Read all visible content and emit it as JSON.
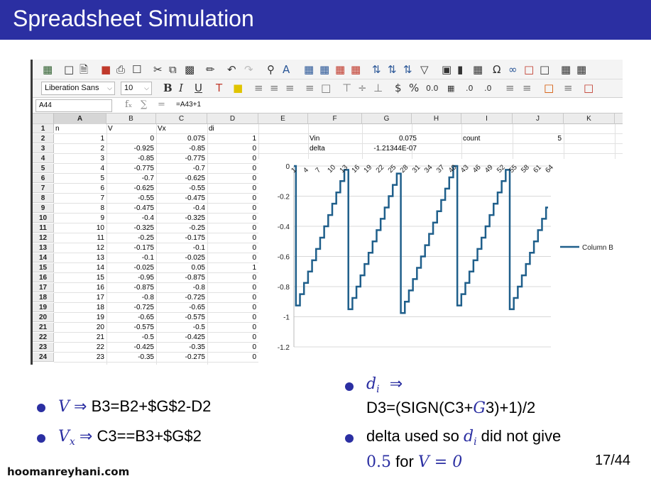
{
  "slide": {
    "title": "Spreadsheet Simulation",
    "page_number": "17/44",
    "watermark": "hoomanreyhani.com"
  },
  "spreadsheet": {
    "font_name": "Liberation Sans",
    "font_size": "10",
    "cell_ref": "A44",
    "formula": "=A43+1",
    "fx_symbol": "fₓ",
    "sum_symbol": "∑",
    "eq_symbol": "=",
    "columns": [
      "A",
      "B",
      "C",
      "D",
      "E",
      "F",
      "G",
      "H",
      "I",
      "J",
      "K"
    ],
    "selected_column": "A",
    "rows": [
      [
        "n",
        "V",
        "Vx",
        "di",
        "",
        "",
        "",
        "",
        "",
        "",
        ""
      ],
      [
        "1",
        "0",
        "0.075",
        "1",
        "",
        "Vin",
        "0.075",
        "",
        "count",
        "5",
        ""
      ],
      [
        "2",
        "-0.925",
        "-0.85",
        "0",
        "",
        "delta",
        "-1.21344E-07",
        "",
        "",
        "",
        ""
      ],
      [
        "3",
        "-0.85",
        "-0.775",
        "0",
        "",
        "",
        "",
        "",
        "",
        "",
        ""
      ],
      [
        "4",
        "-0.775",
        "-0.7",
        "0",
        "",
        "",
        "",
        "",
        "",
        "",
        ""
      ],
      [
        "5",
        "-0.7",
        "-0.625",
        "0",
        "",
        "",
        "",
        "",
        "",
        "",
        ""
      ],
      [
        "6",
        "-0.625",
        "-0.55",
        "0",
        "",
        "",
        "",
        "",
        "",
        "",
        ""
      ],
      [
        "7",
        "-0.55",
        "-0.475",
        "0",
        "",
        "",
        "",
        "",
        "",
        "",
        ""
      ],
      [
        "8",
        "-0.475",
        "-0.4",
        "0",
        "",
        "",
        "",
        "",
        "",
        "",
        ""
      ],
      [
        "9",
        "-0.4",
        "-0.325",
        "0",
        "",
        "",
        "",
        "",
        "",
        "",
        ""
      ],
      [
        "10",
        "-0.325",
        "-0.25",
        "0",
        "",
        "",
        "",
        "",
        "",
        "",
        ""
      ],
      [
        "11",
        "-0.25",
        "-0.175",
        "0",
        "",
        "",
        "",
        "",
        "",
        "",
        ""
      ],
      [
        "12",
        "-0.175",
        "-0.1",
        "0",
        "",
        "",
        "",
        "",
        "",
        "",
        ""
      ],
      [
        "13",
        "-0.1",
        "-0.025",
        "0",
        "",
        "",
        "",
        "",
        "",
        "",
        ""
      ],
      [
        "14",
        "-0.025",
        "0.05",
        "1",
        "",
        "",
        "",
        "",
        "",
        "",
        ""
      ],
      [
        "15",
        "-0.95",
        "-0.875",
        "0",
        "",
        "",
        "",
        "",
        "",
        "",
        ""
      ],
      [
        "16",
        "-0.875",
        "-0.8",
        "0",
        "",
        "",
        "",
        "",
        "",
        "",
        ""
      ],
      [
        "17",
        "-0.8",
        "-0.725",
        "0",
        "",
        "",
        "",
        "",
        "",
        "",
        ""
      ],
      [
        "18",
        "-0.725",
        "-0.65",
        "0",
        "",
        "",
        "",
        "",
        "",
        "",
        ""
      ],
      [
        "19",
        "-0.65",
        "-0.575",
        "0",
        "",
        "",
        "",
        "",
        "",
        "",
        ""
      ],
      [
        "20",
        "-0.575",
        "-0.5",
        "0",
        "",
        "",
        "",
        "",
        "",
        "",
        ""
      ],
      [
        "21",
        "-0.5",
        "-0.425",
        "0",
        "",
        "",
        "",
        "",
        "",
        "",
        ""
      ],
      [
        "22",
        "-0.425",
        "-0.35",
        "0",
        "",
        "",
        "",
        "",
        "",
        "",
        ""
      ],
      [
        "23",
        "-0.35",
        "-0.275",
        "0",
        "",
        "",
        "",
        "",
        "",
        "",
        ""
      ]
    ]
  },
  "chart_data": {
    "type": "line",
    "legend": "Column B",
    "legend_position": "right",
    "x_ticks": [
      "1",
      "4",
      "7",
      "10",
      "13",
      "16",
      "19",
      "22",
      "25",
      "28",
      "31",
      "34",
      "37",
      "40",
      "43",
      "46",
      "49",
      "52",
      "55",
      "58",
      "61",
      "64"
    ],
    "y_ticks": [
      "0",
      "-0.2",
      "-0.4",
      "-0.6",
      "-0.8",
      "-1",
      "-1.2"
    ],
    "ylim": [
      -1.2,
      0
    ],
    "grid": "horizontal",
    "series": [
      {
        "name": "Column B",
        "values": [
          0,
          -0.925,
          -0.85,
          -0.775,
          -0.7,
          -0.625,
          -0.55,
          -0.475,
          -0.4,
          -0.325,
          -0.25,
          -0.175,
          -0.1,
          -0.025,
          -0.95,
          -0.875,
          -0.8,
          -0.725,
          -0.65,
          -0.575,
          -0.5,
          -0.425,
          -0.35,
          -0.275,
          -0.2,
          -0.125,
          -0.05,
          -0.975,
          -0.9,
          -0.825,
          -0.75,
          -0.675,
          -0.6,
          -0.525,
          -0.45,
          -0.375,
          -0.3,
          -0.225,
          -0.15,
          -0.075,
          0,
          -0.925,
          -0.85,
          -0.775,
          -0.7,
          -0.625,
          -0.55,
          -0.475,
          -0.4,
          -0.325,
          -0.25,
          -0.175,
          -0.1,
          -0.025,
          -0.95,
          -0.875,
          -0.8,
          -0.725,
          -0.65,
          -0.575,
          -0.5,
          -0.425,
          -0.35,
          -0.275
        ]
      }
    ],
    "color": "#1f5f8b"
  },
  "bullets_left": {
    "b1_var": "V",
    "b1_arrow": "⇒",
    "b1_text": "B3=B2+$G$2-D2",
    "b2_var": "V",
    "b2_sub": "x",
    "b2_arrow": "⇒",
    "b2_text": "C3==B3+$G$2"
  },
  "bullets_right": {
    "b1_var": "d",
    "b1_sub": "i",
    "b1_arrow": "⇒",
    "b1_line2_a": "D3=(SIGN(C3+",
    "b1_line2_g": "G",
    "b1_line2_b": "3)+1)/2",
    "b2_text_a": "delta used so ",
    "b2_var": "d",
    "b2_sub": "i",
    "b2_text_b": " did not give",
    "b2_line2_num": "0.5",
    "b2_line2_for": " for ",
    "b2_line2_expr": "V = 0"
  },
  "colors": {
    "title_bg": "#2b2fa2",
    "accent": "#2b2fa2",
    "chart_line": "#1f5f8b"
  }
}
